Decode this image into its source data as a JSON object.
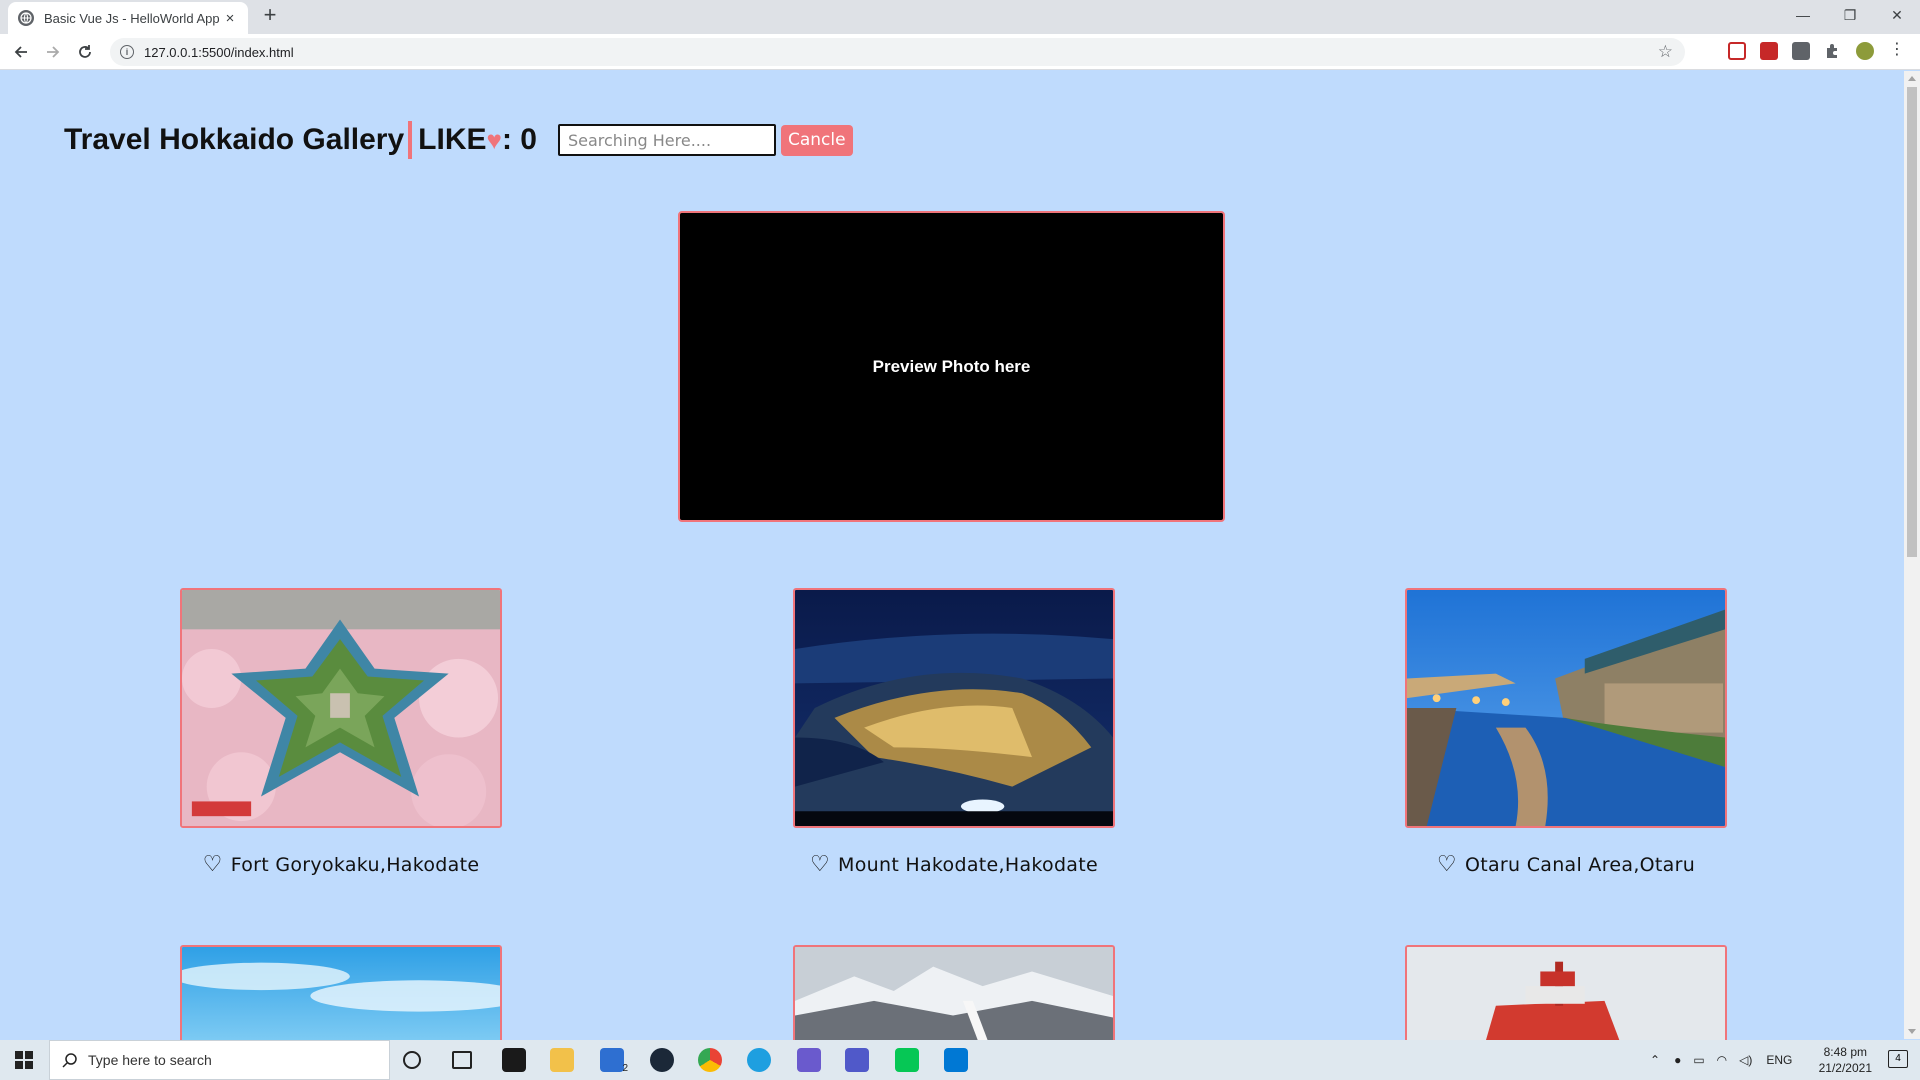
{
  "browser": {
    "tab_title": "Basic Vue Js - HelloWorld App",
    "tab_close": "×",
    "new_tab": "+",
    "url": "127.0.0.1:5500/index.html",
    "win_minimize": "—",
    "win_restore": "❐",
    "win_close": "✕"
  },
  "header": {
    "title": "Travel Hokkaido Gallery",
    "like_label": "LIKE",
    "like_heart": "♥",
    "like_suffix": ": 0",
    "search_placeholder": "Searching Here....",
    "cancel_label": "Cancle"
  },
  "preview": {
    "text": "Preview Photo here"
  },
  "gallery": [
    {
      "caption": "Fort Goryokaku,Hakodate",
      "image": "fort-goryokaku-photo"
    },
    {
      "caption": "Mount Hakodate,Hakodate",
      "image": "night-city-photo"
    },
    {
      "caption": "Otaru Canal Area,Otaru",
      "image": "otaru-canal-photo"
    }
  ],
  "gallery_row2": [
    {
      "image": "blue-sky-photo"
    },
    {
      "image": "snow-mountain-photo"
    },
    {
      "image": "icebreaker-ship-photo"
    }
  ],
  "taskbar": {
    "search_placeholder": "Type here to search",
    "lang": "ENG",
    "time": "8:48 pm",
    "date": "21/2/2021",
    "notifications": "4",
    "mail_badge": "2"
  },
  "colors": {
    "page_background": "#bfdbfd",
    "accent": "#f0747a"
  }
}
